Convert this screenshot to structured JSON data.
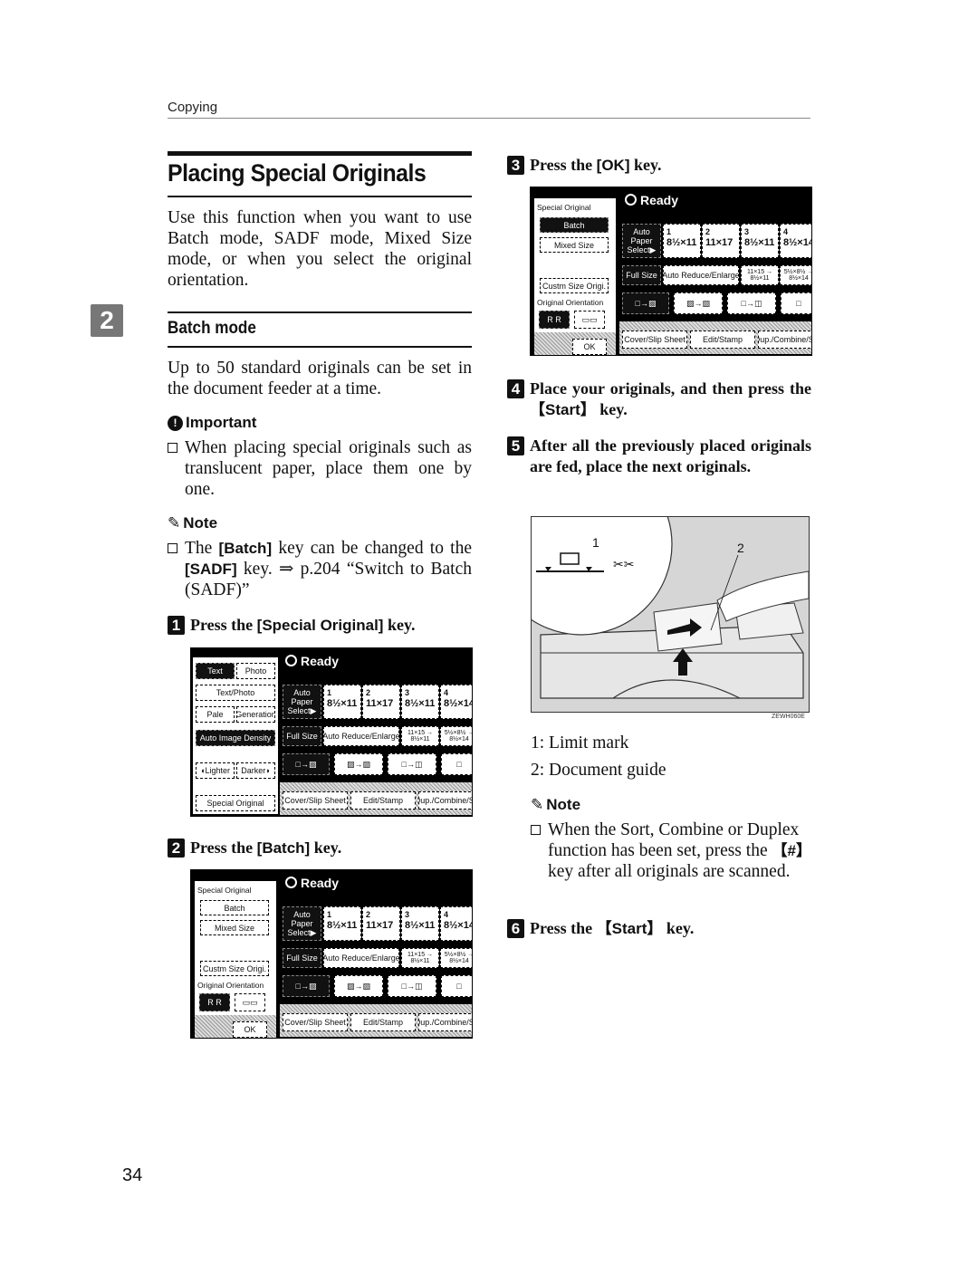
{
  "running_head": "Copying",
  "page_number": "34",
  "chapter_tab": "2",
  "title": "Placing Special Originals",
  "intro": "Use this function when you want to use Batch mode, SADF mode, Mixed Size mode, or when you select the original orientation.",
  "section": {
    "heading": "Batch mode",
    "body": "Up to 50 standard originals can be set in the document feeder at a time."
  },
  "important": {
    "label": "Important",
    "items": [
      "When placing special originals such as translucent paper, place them one by one."
    ]
  },
  "note1": {
    "label": "Note",
    "pre": "The ",
    "key1": "[Batch]",
    "mid": " key can be changed to the ",
    "key2": "[SADF]",
    "post": " key. ⇒ p.204 “Switch to Batch (SADF)”"
  },
  "steps": [
    {
      "num": "1",
      "pre": "Press the ",
      "key": "[Special Original]",
      "post": " key."
    },
    {
      "num": "2",
      "pre": "Press the ",
      "key": "[Batch]",
      "post": " key."
    },
    {
      "num": "3",
      "pre": "Press the ",
      "key": "[OK]",
      "post": " key."
    },
    {
      "num": "4",
      "pre": "Place your originals, and then press the ",
      "key": "【Start】",
      "post": " key."
    },
    {
      "num": "5",
      "text": "After all the previously placed originals are fed, place the next originals."
    },
    {
      "num": "6",
      "pre": "Press the ",
      "key": "【Start】",
      "post": " key."
    }
  ],
  "illustration": {
    "callouts": [
      "1",
      "2"
    ],
    "code": "ZEWH060E",
    "legend": [
      "1: Limit mark",
      "2: Document guide"
    ]
  },
  "note2": {
    "label": "Note",
    "pre": "When the Sort, Combine or Duplex function has been set, press the ",
    "key": "【#】",
    "post": " key after all originals are scanned."
  },
  "panel_common": {
    "status": "Ready",
    "auto_paper": "Auto Paper Select▶",
    "trays": [
      {
        "n": "1",
        "size": "8½×11"
      },
      {
        "n": "2",
        "size": "11×17"
      },
      {
        "n": "3",
        "size": "8½×11"
      },
      {
        "n": "4",
        "size": "8½×14"
      }
    ],
    "full_size": "Full Size",
    "auto_reduce": "Auto Reduce/Enlarge",
    "ratio1": "11×15 → 8½×11",
    "ratio2": "5½×8½ → 8½×14",
    "bottom": [
      "Cover/Slip Sheet",
      "Edit/Stamp",
      "Dup./Combine/Sort"
    ]
  },
  "panel1_left": {
    "text": "Text",
    "photo": "Photo",
    "text_photo": "Text/Photo",
    "pale": "Pale",
    "generation": "Generation",
    "auto_density": "Auto Image Density",
    "lighter": "◖Lighter",
    "darker": "Darker◗",
    "special_original": "Special Original"
  },
  "panel_special": {
    "heading": "Special Original",
    "batch": "Batch",
    "mixed": "Mixed Size",
    "custom": "Custm Size Origi.",
    "orientation": "Original Orientation",
    "ok": "OK"
  }
}
